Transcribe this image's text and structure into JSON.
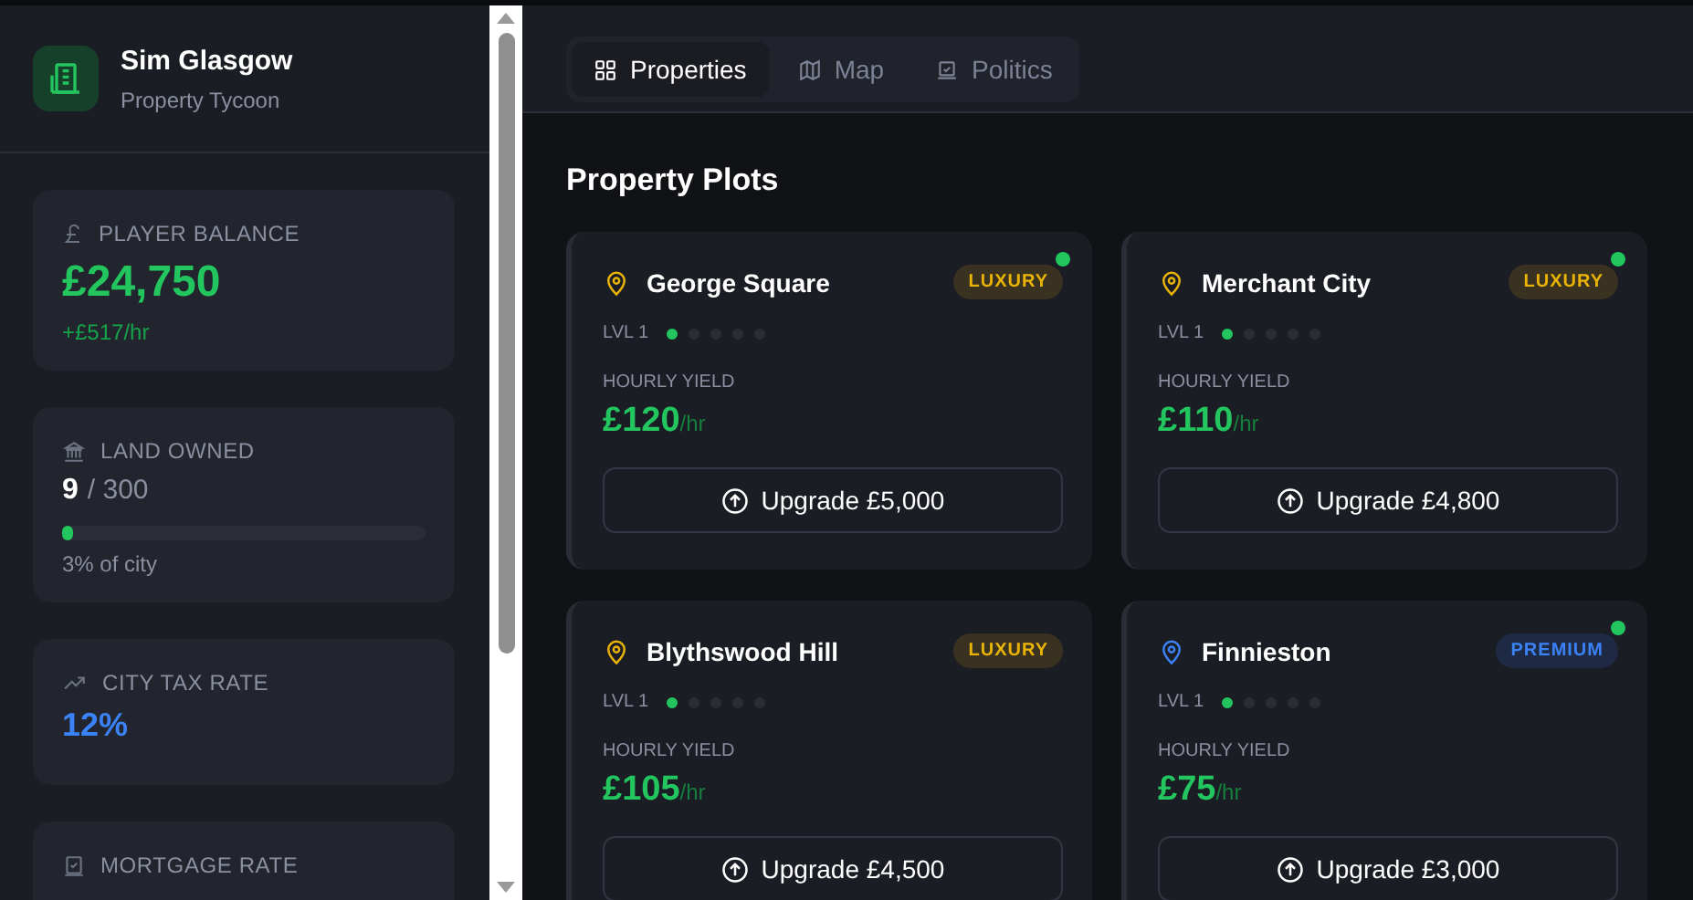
{
  "app": {
    "title": "Sim Glasgow",
    "subtitle": "Property Tycoon"
  },
  "stats": [
    {
      "kind": "balance",
      "label": "PLAYER BALANCE",
      "value": "£24,750",
      "note": "+£517/hr"
    },
    {
      "kind": "land",
      "label": "LAND OWNED",
      "value": "9",
      "total": "/ 300",
      "level": 0.03,
      "note": "3% of city"
    },
    {
      "kind": "tax",
      "label": "CITY TAX RATE",
      "value": "12%"
    },
    {
      "kind": "mortgage",
      "label": "MORTGAGE RATE"
    }
  ],
  "tabs": [
    {
      "label": "Properties",
      "kind": "grid",
      "selected": true
    },
    {
      "label": "Map",
      "kind": "map",
      "selected": false
    },
    {
      "label": "Politics",
      "kind": "vote",
      "selected": false
    }
  ],
  "heading": "Property Plots",
  "plots": [
    {
      "name": "George Square",
      "tier": "LUXURY",
      "kind": "luxury",
      "active": true,
      "level_label": "LVL 1",
      "level": 0.2,
      "yield_label": "HOURLY YIELD",
      "yield": "£120",
      "unit": "/hr",
      "upgrade": "Upgrade £5,000"
    },
    {
      "name": "Merchant City",
      "tier": "LUXURY",
      "kind": "luxury",
      "active": true,
      "level_label": "LVL 1",
      "level": 0.2,
      "yield_label": "HOURLY YIELD",
      "yield": "£110",
      "unit": "/hr",
      "upgrade": "Upgrade £4,800"
    },
    {
      "name": "Blythswood Hill",
      "tier": "LUXURY",
      "kind": "luxury",
      "active": false,
      "level_label": "LVL 1",
      "level": 0.2,
      "yield_label": "HOURLY YIELD",
      "yield": "£105",
      "unit": "/hr",
      "upgrade": "Upgrade £4,500"
    },
    {
      "name": "Finnieston",
      "tier": "PREMIUM",
      "kind": "premium",
      "active": true,
      "level_label": "LVL 1",
      "level": 0.2,
      "yield_label": "HOURLY YIELD",
      "yield": "£75",
      "unit": "/hr",
      "upgrade": "Upgrade £3,000"
    }
  ]
}
